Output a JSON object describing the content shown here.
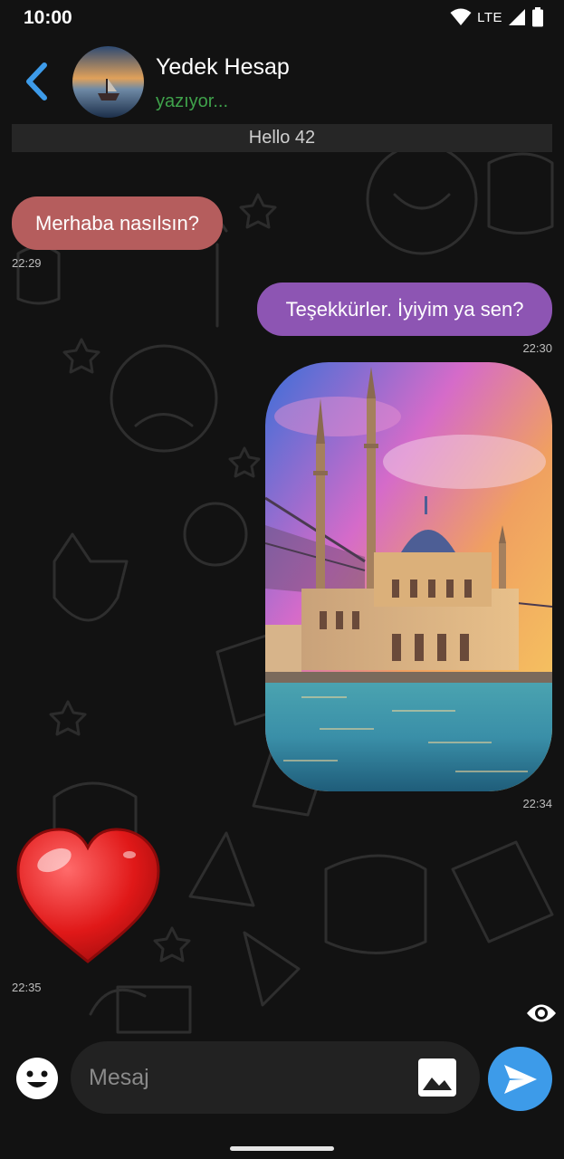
{
  "status_bar": {
    "time": "10:00",
    "network": "LTE",
    "icons": [
      "wifi-icon",
      "signal-icon",
      "battery-icon"
    ]
  },
  "header": {
    "back_icon": "chevron-left-icon",
    "contact_name": "Yedek Hesap",
    "contact_status": "yazıyor..."
  },
  "banner": {
    "text": "Hello 42"
  },
  "messages": [
    {
      "type": "text",
      "direction": "incoming",
      "text": "Merhaba nasılsın?",
      "time": "22:29",
      "color": "#b55d5d"
    },
    {
      "type": "text",
      "direction": "outgoing",
      "text": "Teşekkürler. İyiyim ya sen?",
      "time": "22:30",
      "color": "#8d55b3"
    },
    {
      "type": "image",
      "direction": "outgoing",
      "time": "22:34"
    },
    {
      "type": "sticker",
      "direction": "incoming",
      "sticker": "heart-icon",
      "time": "22:35"
    }
  ],
  "seen_icon": "eye-icon",
  "composer": {
    "emoji_icon": "emoji-icon",
    "placeholder": "Mesaj",
    "gallery_icon": "gallery-icon",
    "send_icon": "send-icon"
  },
  "colors": {
    "background": "#121212",
    "accent": "#3d9be9",
    "typing": "#3fa24b",
    "incoming_bubble": "#b55d5d",
    "outgoing_bubble": "#8d55b3"
  }
}
